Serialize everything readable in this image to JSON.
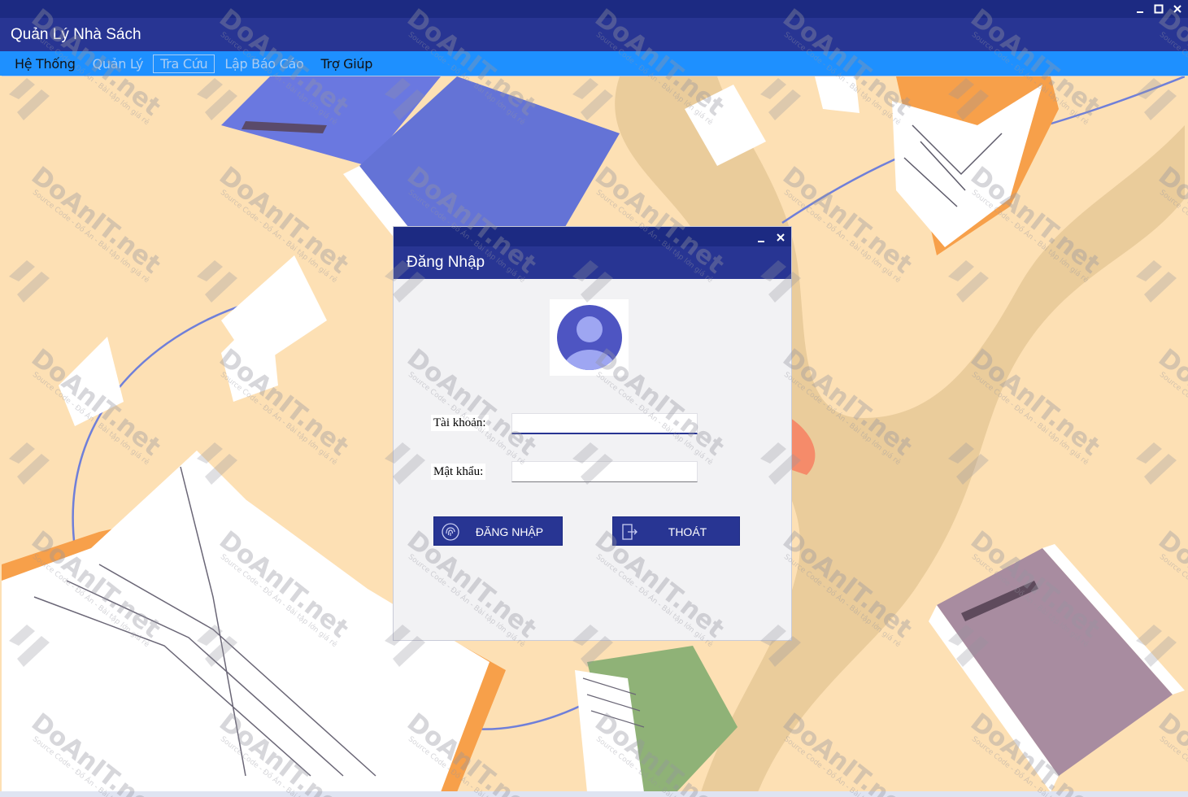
{
  "app": {
    "title": "Quản Lý Nhà Sách",
    "window_controls": [
      "minimize-icon",
      "maximize-icon",
      "close-icon"
    ]
  },
  "menu": {
    "items": [
      {
        "label": "Hệ Thống",
        "enabled": true
      },
      {
        "label": "Quản Lý",
        "enabled": false
      },
      {
        "label": "Tra Cứu",
        "enabled": false,
        "selected": true
      },
      {
        "label": "Lập Báo Cáo",
        "enabled": false
      },
      {
        "label": "Trợ Giúp",
        "enabled": true
      }
    ]
  },
  "login": {
    "title": "Đăng Nhập",
    "window_controls": [
      "minimize-icon",
      "close-icon"
    ],
    "avatar_icon": "user-avatar-icon",
    "username_label": "Tài khoản:",
    "username_value": "",
    "password_label": "Mật khẩu:",
    "password_value": "",
    "login_button": "ĐĂNG NHẬP",
    "login_icon": "fingerprint-login-icon",
    "exit_button": "THOÁT",
    "exit_icon": "exit-door-icon"
  },
  "watermark": {
    "logo_icon": "doanit-logo-icon",
    "main_text": "DoAnIT.net",
    "sub_text": "Source Code - Đồ Án - Bài tập lớn giá rẻ"
  },
  "colors": {
    "primary": "#283593",
    "titlebar": "#1c2a82",
    "menubar": "#1e90ff",
    "background": "#fde0b4",
    "dialog_bg": "#f2f2f4"
  }
}
